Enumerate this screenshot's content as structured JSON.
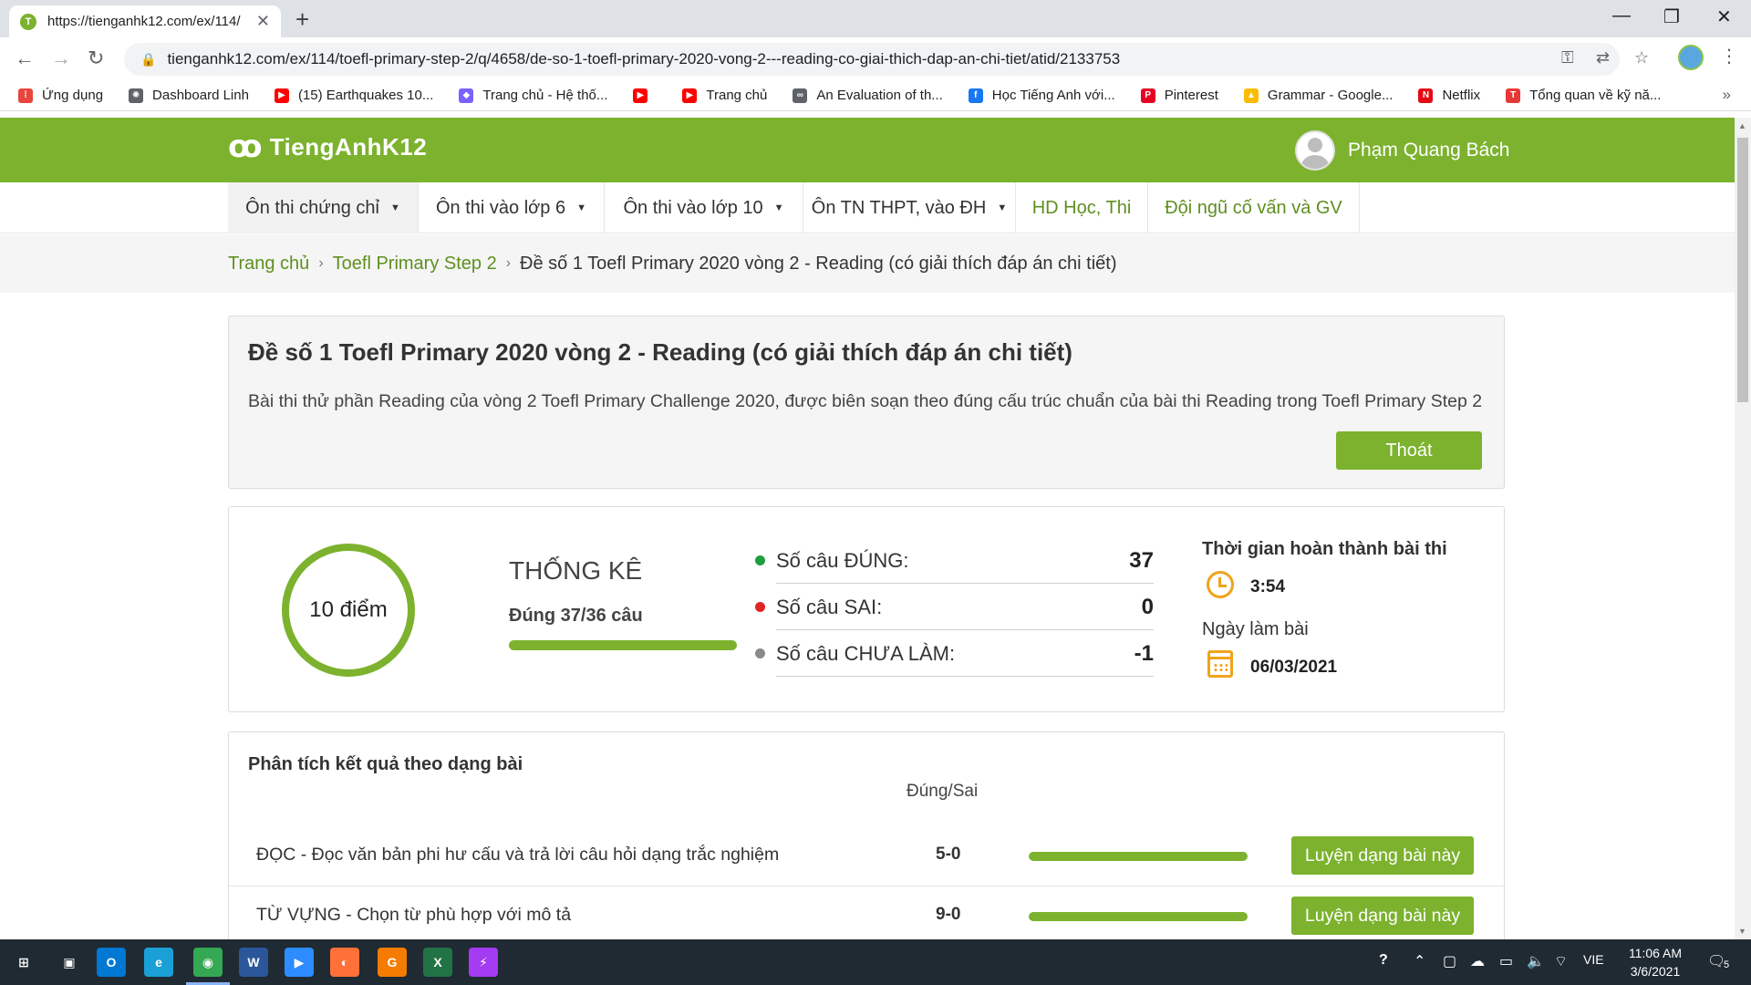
{
  "browser": {
    "tab_title": "https://tienganhk12.com/ex/114/",
    "favicon_letter": "T",
    "url": "tienganhk12.com/ex/114/toefl-primary-step-2/q/4658/de-so-1-toefl-primary-2020-vong-2---reading-co-giai-thich-dap-an-chi-tiet/atid/2133753",
    "bookmarks": [
      {
        "label": "Ứng dụng",
        "icon": "apps-grid-icon",
        "color": "#e8453c",
        "glyph": "⁞"
      },
      {
        "label": "Dashboard Linh",
        "icon": "dashboard-icon",
        "color": "#5f6368",
        "glyph": "✺"
      },
      {
        "label": "(15) Earthquakes 10...",
        "icon": "youtube-icon",
        "color": "#ff0000",
        "glyph": "▶"
      },
      {
        "label": "Trang chủ - Hệ thố...",
        "icon": "diamond-icon",
        "color": "#7b61ff",
        "glyph": "◆"
      },
      {
        "label": "",
        "icon": "youtube-icon",
        "color": "#ff0000",
        "glyph": "▶"
      },
      {
        "label": "Trang chủ",
        "icon": "youtube-icon",
        "color": "#ff0000",
        "glyph": "▶"
      },
      {
        "label": "An Evaluation of th...",
        "icon": "link-icon",
        "color": "#5f6368",
        "glyph": "∞"
      },
      {
        "label": "Học Tiếng Anh với...",
        "icon": "facebook-icon",
        "color": "#1877f2",
        "glyph": "f"
      },
      {
        "label": "Pinterest",
        "icon": "pinterest-icon",
        "color": "#e60023",
        "glyph": "P"
      },
      {
        "label": "Grammar - Google...",
        "icon": "google-drive-icon",
        "color": "#fbbc04",
        "glyph": "▲"
      },
      {
        "label": "Netflix",
        "icon": "netflix-icon",
        "color": "#e50914",
        "glyph": "N"
      },
      {
        "label": "Tổng quan về kỹ nă...",
        "icon": "bookmark-p-icon",
        "color": "#e53935",
        "glyph": "T"
      }
    ]
  },
  "site": {
    "logo_text": "TiengAnhK12",
    "logo_mark": "ꝏ",
    "user_name": "Phạm Quang Bách",
    "nav": [
      {
        "label": "Ôn thi chứng chỉ",
        "caret": "▼"
      },
      {
        "label": "Ôn thi vào lớp 6",
        "caret": "▼"
      },
      {
        "label": "Ôn thi vào lớp 10",
        "caret": "▼"
      },
      {
        "label": "Ôn TN THPT, vào ĐH",
        "caret": "▼"
      },
      {
        "label": "HD Học, Thi",
        "caret": ""
      },
      {
        "label": "Đội ngũ cố vấn và GV",
        "caret": ""
      }
    ],
    "breadcrumb": {
      "home": "Trang chủ",
      "section": "Toefl Primary Step 2",
      "current": "Đề số 1 Toefl Primary 2020 vòng 2 - Reading (có giải thích đáp án chi tiết)",
      "sep": "›"
    }
  },
  "exam": {
    "title": "Đề số 1 Toefl Primary 2020 vòng 2 - Reading (có giải thích đáp án chi tiết)",
    "description": "Bài thi thử phần Reading của vòng 2 Toefl Primary Challenge 2020, được biên soạn theo đúng cấu trúc chuẩn của bài thi Reading trong Toefl Primary Step 2",
    "exit_label": "Thoát"
  },
  "stats": {
    "score_label": "10 điểm",
    "title": "THỐNG KÊ",
    "summary": "Đúng 37/36 câu",
    "progress": 1.0,
    "rows": [
      {
        "label": "Số câu ĐÚNG:",
        "value": "37",
        "color": "#1e9e3e"
      },
      {
        "label": "Số câu SAI:",
        "value": "0",
        "color": "#e02424"
      },
      {
        "label": "Số câu CHƯA LÀM:",
        "value": "-1",
        "color": "#8a8a8a"
      }
    ],
    "time_title": "Thời gian hoàn thành bài thi",
    "time_value": "3:54",
    "date_title": "Ngày làm bài",
    "date_value": "06/03/2021"
  },
  "analysis": {
    "title": "Phân tích kết quả theo dạng bài",
    "column_header": "Đúng/Sai",
    "practice_label": "Luyện dạng bài này",
    "rows": [
      {
        "name": "ĐỌC - Đọc văn bản phi hư cấu và trả lời câu hỏi dạng trắc nghiệm",
        "score": "5-0"
      },
      {
        "name": "TỪ VỰNG - Chọn từ phù hợp với mô tả",
        "score": "9-0"
      }
    ]
  },
  "taskbar": {
    "apps": [
      {
        "icon": "windows-start-icon",
        "glyph": "⊞",
        "color": "#1f2a33"
      },
      {
        "icon": "task-view-icon",
        "glyph": "▣",
        "color": "#1f2a33"
      },
      {
        "icon": "outlook-icon",
        "glyph": "O",
        "color": "#0078d4"
      },
      {
        "icon": "edge-icon",
        "glyph": "e",
        "color": "#1a9fd6"
      },
      {
        "icon": "chrome-icon",
        "glyph": "◉",
        "color": "#34a853"
      },
      {
        "icon": "word-icon",
        "glyph": "W",
        "color": "#2b579a"
      },
      {
        "icon": "zoom-icon",
        "glyph": "▶",
        "color": "#2d8cff"
      },
      {
        "icon": "firefox-icon",
        "glyph": "◐",
        "color": "#ff7139"
      },
      {
        "icon": "pdf-icon",
        "glyph": "G",
        "color": "#f57c00"
      },
      {
        "icon": "excel-icon",
        "glyph": "X",
        "color": "#217346"
      },
      {
        "icon": "messenger-icon",
        "glyph": "⚡",
        "color": "#a33bf2"
      }
    ],
    "lang": "VIE",
    "time": "11:06 AM",
    "date": "3/6/2021",
    "notifications": "5"
  }
}
